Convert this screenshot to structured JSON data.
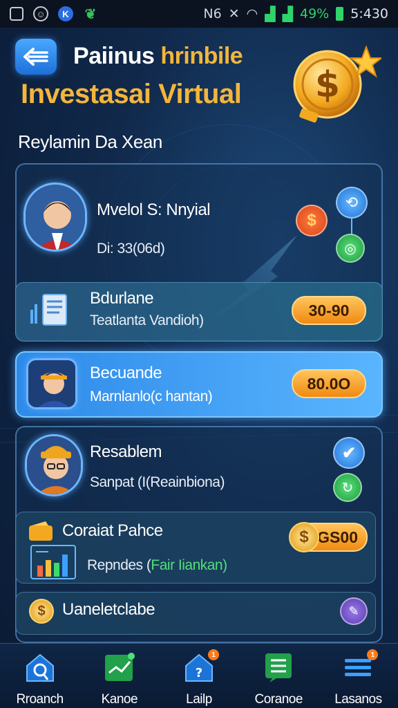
{
  "status_bar": {
    "network": "N6",
    "battery_pct": "49%",
    "time": "5:430"
  },
  "header": {
    "title_white": "Paiinus",
    "title_gold": "hrinbile",
    "subtitle": "Investasai Virtual"
  },
  "section_title": "Reylamin Da Xean",
  "profile": {
    "name": "Mvelol S: Nnyial",
    "id": "Di: 33(06d)"
  },
  "items": [
    {
      "title": "Bdurlane",
      "desc": "Teatlanta Vandioh)",
      "value": "30-90"
    },
    {
      "title": "Becuande",
      "desc": "Marnlanlo(c hantan)",
      "value": "80.0O"
    }
  ],
  "resabelm": {
    "title": "Resablem",
    "desc": "Sanpat (I(Reainbiona)",
    "sub1_title": "Coraiat Pahce",
    "sub1_desc_prefix": "Repndes (",
    "sub1_desc_green": "Fair Iiankan)",
    "sub1_value": "GS00",
    "sub2_title": "Uaneletclabe"
  },
  "nav": [
    {
      "label": "Rroanch",
      "icon": "home-search-icon",
      "badge": ""
    },
    {
      "label": "Kanoe",
      "icon": "chart-icon",
      "badge": ""
    },
    {
      "label": "Lailp",
      "icon": "house-help-icon",
      "badge": "1"
    },
    {
      "label": "Coranoe",
      "icon": "list-icon",
      "badge": ""
    },
    {
      "label": "Lasanos",
      "icon": "menu-icon",
      "badge": "1"
    }
  ],
  "colors": {
    "accent_gold": "#f3b53c",
    "accent_blue": "#2d8ae8",
    "background": "#10284a"
  }
}
